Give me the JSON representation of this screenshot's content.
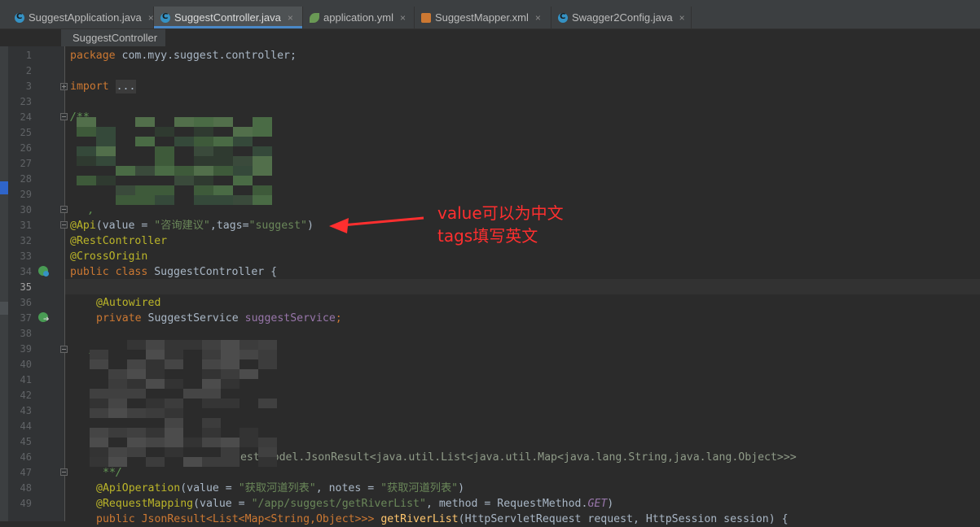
{
  "tabs": [
    {
      "label": "SuggestApplication.java",
      "icon": "java-class-icon",
      "active": false
    },
    {
      "label": "SuggestController.java",
      "icon": "java-class-icon",
      "active": true
    },
    {
      "label": "application.yml",
      "icon": "spring-config-icon",
      "active": false
    },
    {
      "label": "SuggestMapper.xml",
      "icon": "xml-file-icon",
      "active": false
    },
    {
      "label": "Swagger2Config.java",
      "icon": "java-class-icon",
      "active": false
    }
  ],
  "tab_close_glyph": "×",
  "breadcrumb": "SuggestController",
  "line_numbers": [
    "1",
    "2",
    "3",
    "23",
    "24",
    "25",
    "26",
    "27",
    "28",
    "29",
    "30",
    "31",
    "32",
    "33",
    "34",
    "35",
    "36",
    "37",
    "38",
    "39",
    "40",
    "41",
    "42",
    "43",
    "44",
    "45",
    "46",
    "47",
    "48",
    "49"
  ],
  "current_line": "35",
  "code": {
    "l1_kw": "package",
    "l1_rest": " com.myy.suggest.controller;",
    "l3_kw": "import",
    "l3_fold": "...",
    "l24": "/**",
    "l30": ",",
    "l31_ann": "@Api",
    "l31_a": "(value = ",
    "l31_s1": "\"咨询建议\"",
    "l31_b": ",tags=",
    "l31_s2": "\"suggest\"",
    "l31_c": ")",
    "l32": "@RestController",
    "l33": "@CrossOrigin",
    "l34_kw": "public class",
    "l34_rest": " SuggestController {",
    "l36": "@Autowired",
    "l37_kw": "private",
    "l37_type": " SuggestService ",
    "l37_field": "suggestService",
    "l37_end": ";",
    "l39": ",",
    "l46": "gest.model.JsonResult<java.util.List<java.util.Map<java.lang.String,java.lang.Object>>>",
    "l47": "**/",
    "l48_ann": "@ApiOperation",
    "l48_a": "(value = ",
    "l48_s1": "\"获取河道列表\"",
    "l48_b": ", notes = ",
    "l48_s2": "\"获取河道列表\"",
    "l48_c": ")",
    "l49_ann": "@RequestMapping",
    "l49_a": "(value = ",
    "l49_s1": "\"/app/suggest/getRiverList\"",
    "l49_b": ", method = RequestMethod.",
    "l49_get": "GET",
    "l49_c": ")",
    "l50_a": "public JsonResult<List<Map<String,Object>>> ",
    "l50_m": "getRiverList",
    "l50_b": "(HttpServletRequest request, HttpSession session) {"
  },
  "annotation_note": {
    "line1": "value可以为中文",
    "line2": "tags填写英文",
    "color": "#ff2f2f"
  },
  "colors": {
    "keyword": "#cc7832",
    "annotation": "#bbb529",
    "string": "#6a8759",
    "comment": "#629755",
    "field": "#9876aa",
    "text": "#a9b7c6",
    "background": "#2b2b2b",
    "accent": "#4a88c7"
  }
}
